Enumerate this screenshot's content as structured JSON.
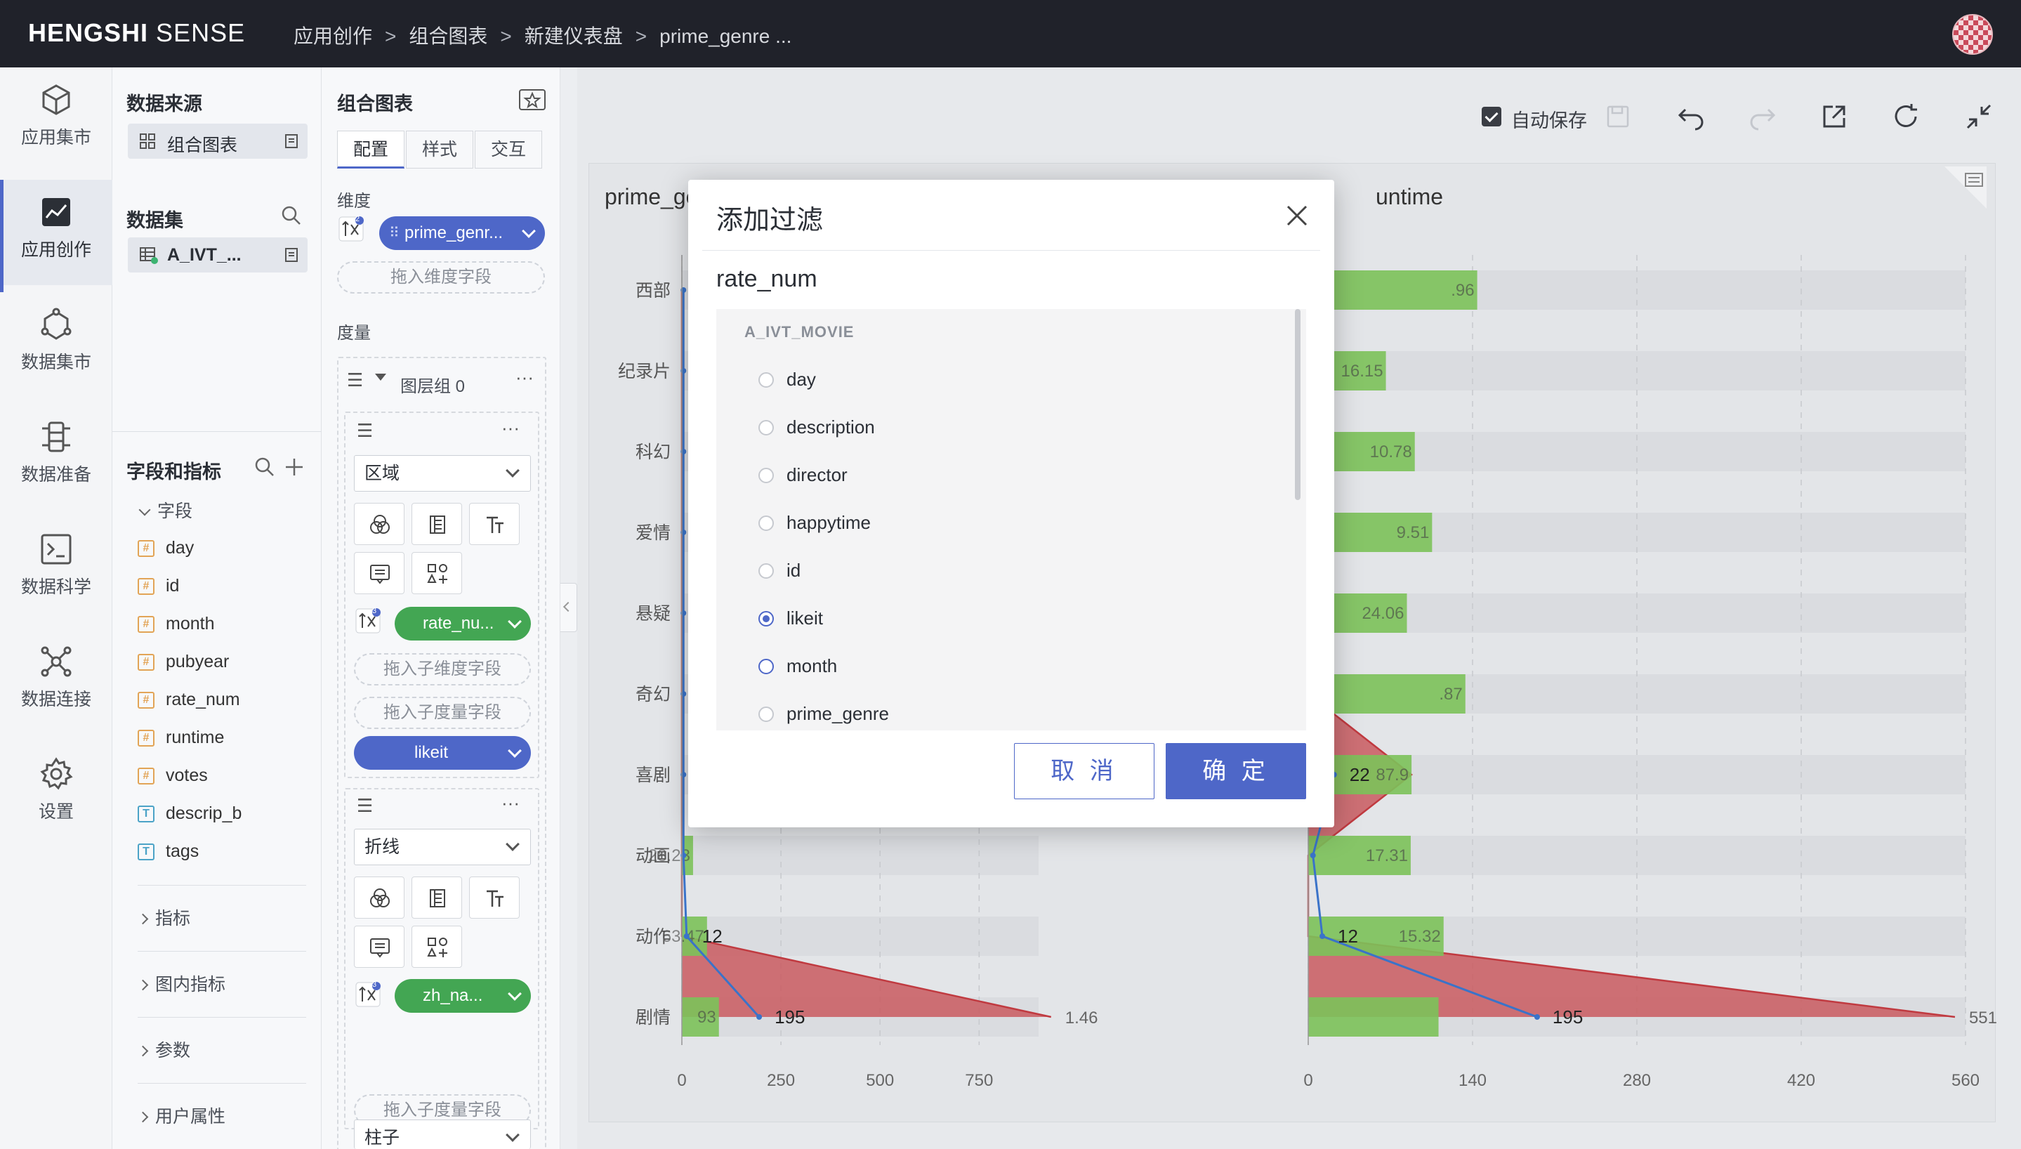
{
  "app": {
    "brand_bold": "HENGSHI",
    "brand_light": "SENSE",
    "breadcrumbs": [
      "应用创作",
      "组合图表",
      "新建仪表盘",
      "prime_genre ..."
    ],
    "breadcrumb_sep": ">"
  },
  "leftnav": {
    "items": [
      {
        "label": "应用集市",
        "icon": "cube-icon"
      },
      {
        "label": "应用创作",
        "icon": "chart-create-icon",
        "active": true
      },
      {
        "label": "数据集市",
        "icon": "network-icon"
      },
      {
        "label": "数据准备",
        "icon": "data-prep-icon"
      },
      {
        "label": "数据科学",
        "icon": "terminal-icon"
      },
      {
        "label": "数据连接",
        "icon": "connection-icon"
      },
      {
        "label": "设置",
        "icon": "gear-icon"
      }
    ]
  },
  "datapanel": {
    "source_title": "数据来源",
    "source_item": "组合图表",
    "dataset_title": "数据集",
    "dataset_item": "A_IVT_...",
    "fields_title": "字段和指标",
    "fields_group": "字段",
    "fields": [
      {
        "name": "day",
        "type": "number"
      },
      {
        "name": "id",
        "type": "number"
      },
      {
        "name": "month",
        "type": "number"
      },
      {
        "name": "pubyear",
        "type": "number"
      },
      {
        "name": "rate_num",
        "type": "number"
      },
      {
        "name": "runtime",
        "type": "number"
      },
      {
        "name": "votes",
        "type": "number"
      },
      {
        "name": "descrip_b",
        "type": "text"
      },
      {
        "name": "tags",
        "type": "text"
      }
    ],
    "collapsed": [
      "指标",
      "图内指标",
      "参数",
      "用户属性"
    ]
  },
  "confpanel": {
    "title": "组合图表",
    "tabs": [
      "配置",
      "样式",
      "交互"
    ],
    "dimension_label": "维度",
    "dimension_pill": "prime_genr...",
    "dimension_badge": "2",
    "drop_dimension": "拖入维度字段",
    "measure_label": "度量",
    "layer_group": "图层组 0",
    "layer1_type": "区域",
    "layer1_pill": "rate_nu...",
    "layer1_badge": "3",
    "drop_sub_dimension": "拖入子维度字段",
    "drop_sub_measure": "拖入子度量字段",
    "layer1_measure": "likeit",
    "layer2_type": "折线",
    "layer2_pill": "zh_na...",
    "layer2_badge": "3",
    "drop_sub_measure_2": "拖入子度量字段",
    "layer3_type": "柱子"
  },
  "toolbar": {
    "autosave_label": "自动保存",
    "autosave_checked": true
  },
  "chart": {
    "left_title": "prime_ge",
    "right_title": "untime"
  },
  "chart_data": [
    {
      "type": "bar",
      "categories": [
        "西部",
        "纪录片",
        "科幻",
        "爱情",
        "悬疑",
        "奇幻",
        "喜剧",
        "动画",
        "动作",
        "剧情"
      ],
      "x_ticks": [
        "0",
        "250",
        "500",
        "750"
      ],
      "xlim": [
        0,
        900
      ],
      "bar_values": [
        null,
        null,
        null,
        null,
        null,
        null,
        null,
        28.23,
        63.47,
        93.46
      ],
      "bar_labels": [
        "",
        "",
        "",
        "",
        "",
        "",
        "",
        "28.23",
        "63.47",
        "93"
      ],
      "area_values": [
        null,
        null,
        null,
        null,
        null,
        null,
        null,
        null,
        null,
        931.46
      ],
      "area_end_label": "1.46",
      "line_values": [
        null,
        null,
        null,
        null,
        null,
        null,
        null,
        null,
        12,
        195
      ],
      "line_labels": [
        "",
        "",
        "",
        "",
        "",
        "",
        "",
        "",
        "12",
        "195"
      ]
    },
    {
      "type": "bar",
      "categories": [
        "西部",
        "纪录片",
        "科幻",
        "爱情",
        "悬疑",
        "奇幻",
        "喜剧",
        "动画",
        "动作",
        "剧情"
      ],
      "x_ticks": [
        "0",
        "140",
        "280",
        "420",
        "560"
      ],
      "xlim": [
        0,
        560
      ],
      "bar_values": [
        143.96,
        66.15,
        90.78,
        105.51,
        84.06,
        133.87,
        88,
        87.31,
        115.32,
        111
      ],
      "bar_labels": [
        ".96",
        "16.15",
        "10.78",
        "9.51",
        "24.06",
        ".87",
        "87.9",
        "17.31",
        "15.32",
        ""
      ],
      "area_values": [
        null,
        null,
        null,
        null,
        null,
        null,
        87.9,
        null,
        null,
        551
      ],
      "area_end_label": "551.",
      "line_values": [
        null,
        null,
        null,
        null,
        null,
        null,
        22,
        null,
        12,
        195
      ],
      "line_labels": [
        "",
        "",
        "",
        "",
        "",
        "",
        "22",
        "",
        "12",
        "195"
      ]
    }
  ],
  "modal": {
    "title": "添加过滤",
    "field": "rate_num",
    "group": "A_IVT_MOVIE",
    "options": [
      "day",
      "description",
      "director",
      "happytime",
      "id",
      "likeit",
      "month",
      "prime_genre"
    ],
    "selected": "likeit",
    "hovered": "month",
    "cancel": "取 消",
    "ok": "确 定"
  }
}
